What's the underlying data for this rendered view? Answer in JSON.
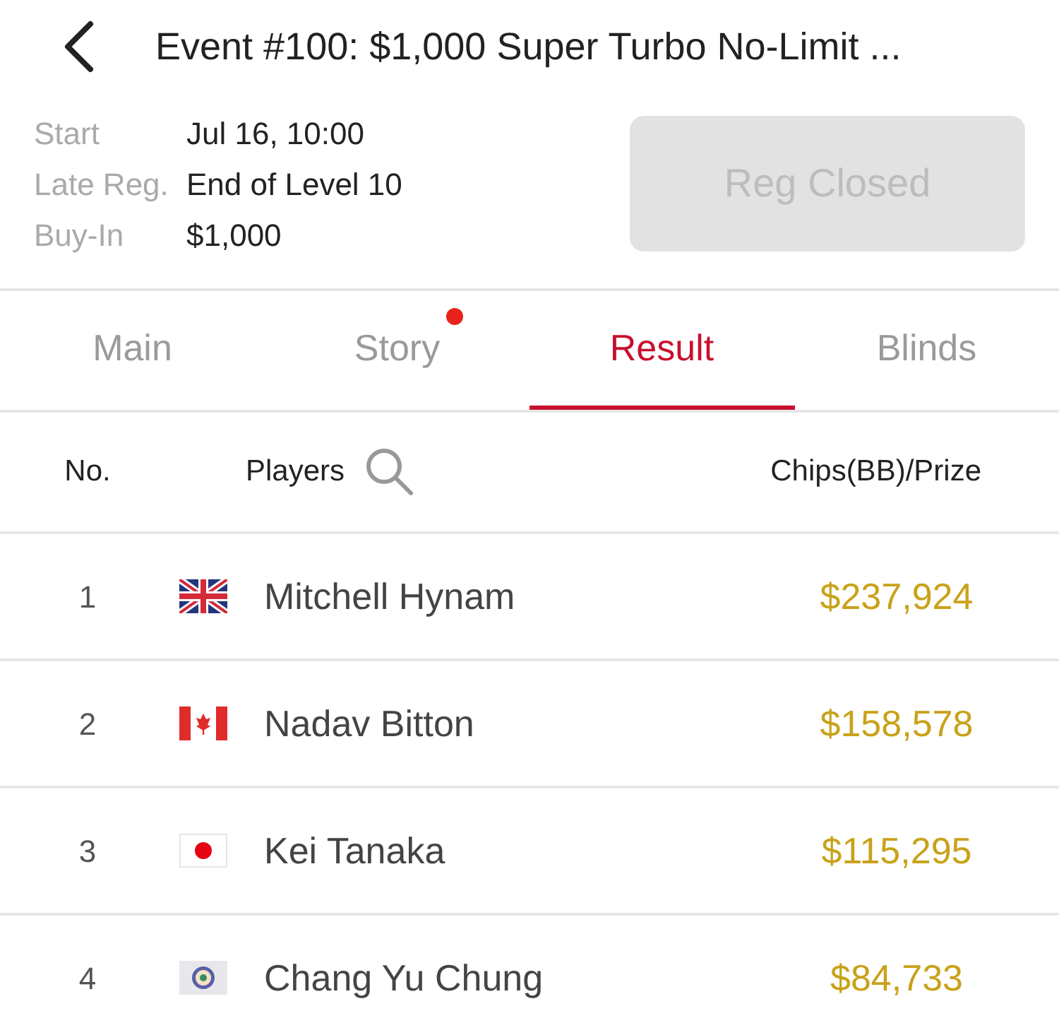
{
  "header": {
    "title": "Event #100: $1,000 Super Turbo No-Limit ..."
  },
  "info": [
    {
      "label": "Start",
      "value": "Jul 16, 10:00"
    },
    {
      "label": "Late Reg.",
      "value": "End of Level 10"
    },
    {
      "label": "Buy-In",
      "value": "$1,000"
    }
  ],
  "register_button": {
    "label": "Reg Closed",
    "disabled": true
  },
  "tabs": [
    {
      "label": "Main",
      "selected": false,
      "notification": false
    },
    {
      "label": "Story",
      "selected": false,
      "notification": true
    },
    {
      "label": "Result",
      "selected": true,
      "notification": false
    },
    {
      "label": "Blinds",
      "selected": false,
      "notification": false
    }
  ],
  "table": {
    "columns": [
      "No.",
      "Players",
      "Chips(BB)/Prize"
    ],
    "rows": [
      {
        "rank": "1",
        "kind": "uk",
        "player": "Mitchell Hynam",
        "prize": "$237,924"
      },
      {
        "rank": "2",
        "kind": "ca",
        "player": "Nadav Bitton",
        "prize": "$158,578"
      },
      {
        "rank": "3",
        "kind": "jp",
        "player": "Kei Tanaka",
        "prize": "$115,295"
      },
      {
        "rank": "4",
        "kind": "tw",
        "player": "Chang Yu Chung",
        "prize": "$84,733"
      }
    ]
  }
}
